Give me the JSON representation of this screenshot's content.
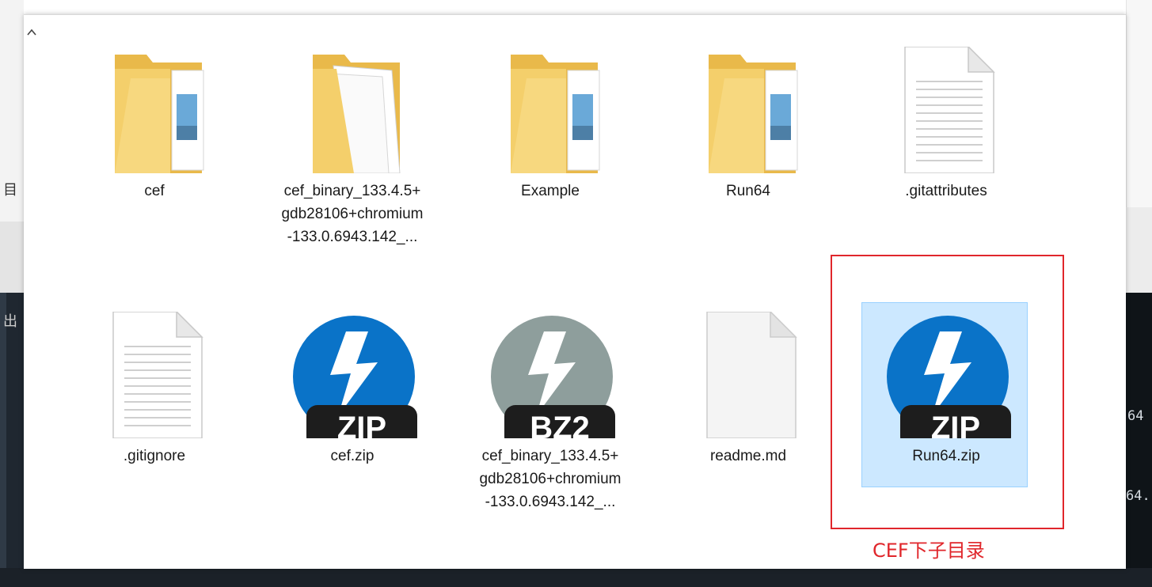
{
  "background": {
    "left_text_1": "目",
    "left_text_2": "出",
    "right_text_1": "64",
    "right_text_2": "64."
  },
  "explorer": {
    "collapse_icon": "chevron-up-icon",
    "items": [
      {
        "name": "cef",
        "icon": "folder-icon"
      },
      {
        "name": "cef_binary_133.4.5+gdb28106+chromium-133.0.6943.142_...",
        "icon": "folder-open-icon"
      },
      {
        "name": "Example",
        "icon": "folder-icon"
      },
      {
        "name": "Run64",
        "icon": "folder-icon"
      },
      {
        "name": ".gitattributes",
        "icon": "text-file-icon"
      },
      {
        "name": ".gitignore",
        "icon": "text-file-icon"
      },
      {
        "name": "cef.zip",
        "icon": "bandizip-zip-icon",
        "badge": "ZIP"
      },
      {
        "name": "cef_binary_133.4.5+gdb28106+chromium-133.0.6943.142_...",
        "icon": "bandizip-bz2-icon",
        "badge": "BZ2"
      },
      {
        "name": "readme.md",
        "icon": "blank-file-icon"
      },
      {
        "name": "Run64.zip",
        "icon": "bandizip-zip-icon",
        "badge": "ZIP",
        "selected": true
      }
    ]
  },
  "annotation": {
    "text": "CEF下子目录",
    "color": "#e0262b"
  },
  "colors": {
    "folder": "#f4cf6b",
    "zip_blue": "#0a73c8",
    "bz2_gray": "#8e9e9c",
    "selection": "#cce8ff"
  }
}
